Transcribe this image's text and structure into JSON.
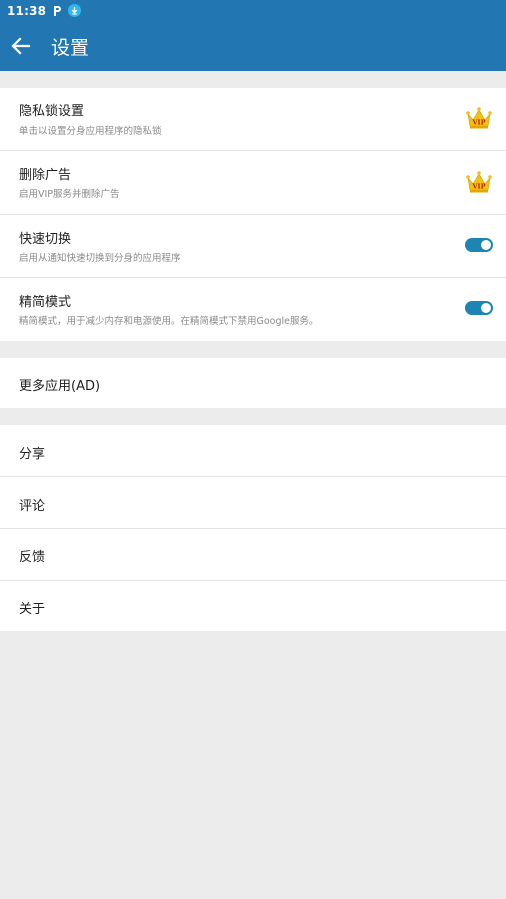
{
  "status_bar": {
    "time": "11:38",
    "icons": [
      "p-notification-icon",
      "download-icon"
    ]
  },
  "toolbar": {
    "back_icon": "arrow-left-icon",
    "title": "设置"
  },
  "colors": {
    "primary": "#2277b2",
    "toggle_on": "#1e84b2",
    "crown": "#f4c20d"
  },
  "settings": {
    "privacy_lock": {
      "label": "隐私锁设置",
      "desc": "单击以设置分身应用程序的隐私锁",
      "badge": "VIP",
      "badge_icon": "vip-crown-icon"
    },
    "remove_ads": {
      "label": "删除广告",
      "desc": "启用VIP服务并删除广告",
      "badge": "VIP",
      "badge_icon": "vip-crown-icon"
    },
    "quick_switch": {
      "label": "快速切换",
      "desc": "启用从通知快速切换到分身的应用程序",
      "enabled": true
    },
    "lite_mode": {
      "label": "精简模式",
      "desc": "精简模式，用于减少内存和电源使用。在精简模式下禁用Google服务。",
      "enabled": true
    }
  },
  "more_apps": {
    "label": "更多应用(AD)"
  },
  "misc": {
    "share": "分享",
    "review": "评论",
    "feedback": "反馈",
    "about": "关于"
  }
}
